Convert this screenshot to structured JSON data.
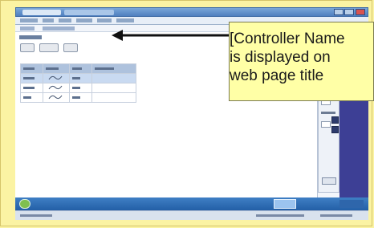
{
  "callout": {
    "text": "[Controller Name\nis displayed on\nweb page title"
  },
  "colors": {
    "frame_background": "#fbf3a3",
    "callout_background": "#ffffa6",
    "arrow": "#101010",
    "taskbar": "#2f6fb8",
    "right_panel": "#3d3f95"
  },
  "icons": {
    "arrow": "left-arrow-icon",
    "start": "start-orb-icon",
    "close": "close-icon"
  }
}
